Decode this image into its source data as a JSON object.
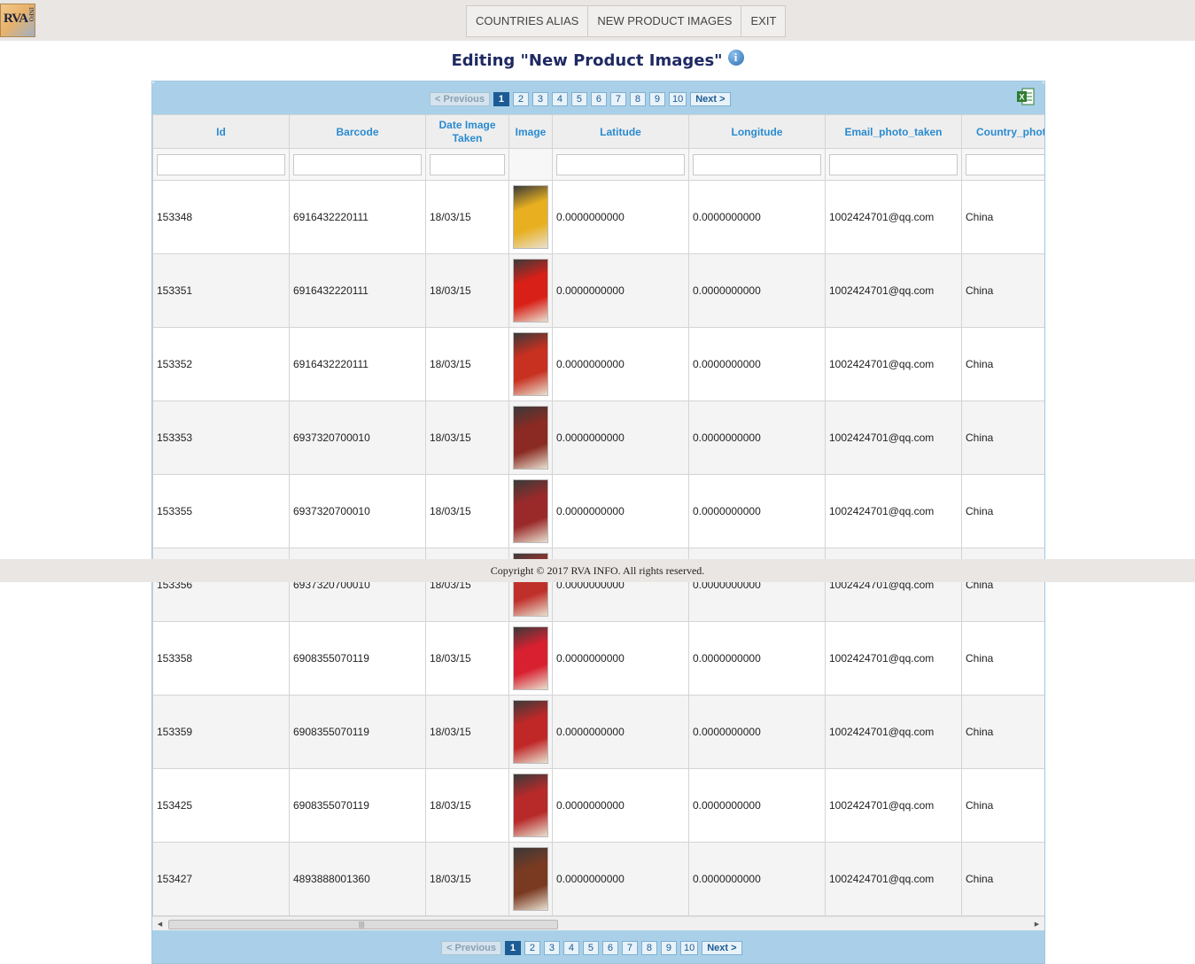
{
  "header": {
    "logo_text": "RVA",
    "logo_sub": "INFO",
    "nav": [
      "COUNTRIES ALIAS",
      "NEW PRODUCT IMAGES",
      "EXIT"
    ]
  },
  "page_title": "Editing \"New Product Images\"",
  "pager": {
    "previous": "< Previous",
    "next": "Next >",
    "pages": [
      "1",
      "2",
      "3",
      "4",
      "5",
      "6",
      "7",
      "8",
      "9",
      "10"
    ],
    "current": "1"
  },
  "table": {
    "columns": [
      "Id",
      "Barcode",
      "Date Image Taken",
      "Image",
      "Latitude",
      "Longitude",
      "Email_photo_taken",
      "Country_photo"
    ],
    "rows": [
      {
        "id": "153348",
        "barcode": "6916432220111",
        "date": "18/03/15",
        "lat": "0.0000000000",
        "lng": "0.0000000000",
        "email": "1002424701@qq.com",
        "country": "China"
      },
      {
        "id": "153351",
        "barcode": "6916432220111",
        "date": "18/03/15",
        "lat": "0.0000000000",
        "lng": "0.0000000000",
        "email": "1002424701@qq.com",
        "country": "China"
      },
      {
        "id": "153352",
        "barcode": "6916432220111",
        "date": "18/03/15",
        "lat": "0.0000000000",
        "lng": "0.0000000000",
        "email": "1002424701@qq.com",
        "country": "China"
      },
      {
        "id": "153353",
        "barcode": "6937320700010",
        "date": "18/03/15",
        "lat": "0.0000000000",
        "lng": "0.0000000000",
        "email": "1002424701@qq.com",
        "country": "China"
      },
      {
        "id": "153355",
        "barcode": "6937320700010",
        "date": "18/03/15",
        "lat": "0.0000000000",
        "lng": "0.0000000000",
        "email": "1002424701@qq.com",
        "country": "China"
      },
      {
        "id": "153356",
        "barcode": "6937320700010",
        "date": "18/03/15",
        "lat": "0.0000000000",
        "lng": "0.0000000000",
        "email": "1002424701@qq.com",
        "country": "China"
      },
      {
        "id": "153358",
        "barcode": "6908355070119",
        "date": "18/03/15",
        "lat": "0.0000000000",
        "lng": "0.0000000000",
        "email": "1002424701@qq.com",
        "country": "China"
      },
      {
        "id": "153359",
        "barcode": "6908355070119",
        "date": "18/03/15",
        "lat": "0.0000000000",
        "lng": "0.0000000000",
        "email": "1002424701@qq.com",
        "country": "China"
      },
      {
        "id": "153425",
        "barcode": "6908355070119",
        "date": "18/03/15",
        "lat": "0.0000000000",
        "lng": "0.0000000000",
        "email": "1002424701@qq.com",
        "country": "China"
      },
      {
        "id": "153427",
        "barcode": "4893888001360",
        "date": "18/03/15",
        "lat": "0.0000000000",
        "lng": "0.0000000000",
        "email": "1002424701@qq.com",
        "country": "China"
      }
    ],
    "thumbnail_colors": [
      "#e8b020",
      "#d82018",
      "#c83020",
      "#8a2a22",
      "#9a2a2a",
      "#c0302a",
      "#d82030",
      "#c02828",
      "#b82a2a",
      "#7a3a22"
    ]
  },
  "footer": {
    "copyright": "Copyright © 2017 RVA INFO. All rights reserved."
  },
  "icons": {
    "info": "info-icon",
    "excel": "excel-export-icon"
  }
}
